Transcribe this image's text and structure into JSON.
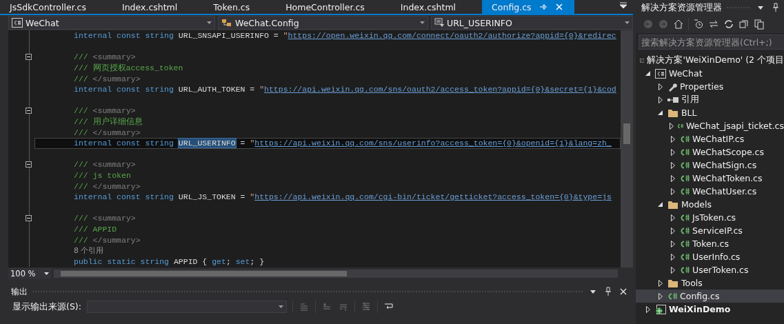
{
  "editor_tabs": [
    {
      "label": "JsSdkController.cs",
      "selected": false
    },
    {
      "label": "Index.cshtml",
      "selected": false
    },
    {
      "label": "Token.cs",
      "selected": false
    },
    {
      "label": "HomeController.cs",
      "selected": false
    },
    {
      "label": "Index.cshtml",
      "selected": false
    },
    {
      "label": "Config.cs",
      "selected": true
    }
  ],
  "nav_bar": {
    "project": "WeChat",
    "type": "WeChat.Config",
    "member": "URL_USERINFO"
  },
  "code_lines": [
    {
      "kind": "code",
      "fold": false,
      "current": false,
      "segments": [
        {
          "kind": "kw",
          "t": "internal const string "
        },
        {
          "kind": "id",
          "t": "URL_SNSAPI_USERINFO = "
        },
        {
          "kind": "punc",
          "t": "\""
        },
        {
          "kind": "link",
          "t": "https://open.weixin.qq.com/connect/oauth2/authorize?appid={0}&redirec"
        }
      ]
    },
    {
      "kind": "blank",
      "fold": false,
      "current": false
    },
    {
      "kind": "code",
      "fold": true,
      "current": false,
      "segments": [
        {
          "kind": "doc",
          "t": "/// "
        },
        {
          "kind": "tag",
          "t": "<summary>"
        }
      ]
    },
    {
      "kind": "code",
      "fold": false,
      "current": false,
      "segments": [
        {
          "kind": "doc",
          "t": "/// 网页授权access_token"
        }
      ]
    },
    {
      "kind": "code",
      "fold": false,
      "current": false,
      "segments": [
        {
          "kind": "doc",
          "t": "/// "
        },
        {
          "kind": "tag",
          "t": "</summary>"
        }
      ]
    },
    {
      "kind": "code",
      "fold": false,
      "current": false,
      "segments": [
        {
          "kind": "kw",
          "t": "internal const string "
        },
        {
          "kind": "id",
          "t": "URL_AUTH_TOKEN = "
        },
        {
          "kind": "punc",
          "t": "\""
        },
        {
          "kind": "link",
          "t": "https://api.weixin.qq.com/sns/oauth2/access_token?appid={0}&secret={1}&cod"
        }
      ]
    },
    {
      "kind": "blank",
      "fold": false,
      "current": false
    },
    {
      "kind": "code",
      "fold": true,
      "current": false,
      "segments": [
        {
          "kind": "doc",
          "t": "/// "
        },
        {
          "kind": "tag",
          "t": "<summary>"
        }
      ]
    },
    {
      "kind": "code",
      "fold": false,
      "current": false,
      "segments": [
        {
          "kind": "doc",
          "t": "/// 用户详细信息"
        }
      ]
    },
    {
      "kind": "code",
      "fold": false,
      "current": false,
      "segments": [
        {
          "kind": "doc",
          "t": "/// "
        },
        {
          "kind": "tag",
          "t": "</summary>"
        }
      ]
    },
    {
      "kind": "code",
      "fold": false,
      "current": true,
      "segments": [
        {
          "kind": "kw",
          "t": "internal const string "
        },
        {
          "kind": "sel",
          "t": "URL_USERINFO"
        },
        {
          "kind": "id",
          "t": " = "
        },
        {
          "kind": "punc",
          "t": "\""
        },
        {
          "kind": "link",
          "t": "https://api.weixin.qq.com/sns/userinfo?access_token={0}&openid={1}&lang=zh_"
        }
      ]
    },
    {
      "kind": "blank",
      "fold": false,
      "current": false
    },
    {
      "kind": "code",
      "fold": true,
      "current": false,
      "segments": [
        {
          "kind": "doc",
          "t": "/// "
        },
        {
          "kind": "tag",
          "t": "<summary>"
        }
      ]
    },
    {
      "kind": "code",
      "fold": false,
      "current": false,
      "segments": [
        {
          "kind": "doc",
          "t": "/// js token"
        }
      ]
    },
    {
      "kind": "code",
      "fold": false,
      "current": false,
      "segments": [
        {
          "kind": "doc",
          "t": "/// "
        },
        {
          "kind": "tag",
          "t": "</summary>"
        }
      ]
    },
    {
      "kind": "code",
      "fold": false,
      "current": false,
      "segments": [
        {
          "kind": "kw",
          "t": "internal const string "
        },
        {
          "kind": "id",
          "t": "URL_JS_TOKEN = "
        },
        {
          "kind": "punc",
          "t": "\""
        },
        {
          "kind": "link",
          "t": "https://api.weixin.qq.com/cgi-bin/ticket/getticket?access_token={0}&type=js"
        }
      ]
    },
    {
      "kind": "blank",
      "fold": false,
      "current": false
    },
    {
      "kind": "code",
      "fold": true,
      "current": false,
      "segments": [
        {
          "kind": "doc",
          "t": "/// "
        },
        {
          "kind": "tag",
          "t": "<summary>"
        }
      ]
    },
    {
      "kind": "code",
      "fold": false,
      "current": false,
      "segments": [
        {
          "kind": "doc",
          "t": "/// APPID"
        }
      ]
    },
    {
      "kind": "code",
      "fold": false,
      "current": false,
      "segments": [
        {
          "kind": "doc",
          "t": "/// "
        },
        {
          "kind": "tag",
          "t": "</summary>"
        }
      ]
    },
    {
      "kind": "lens",
      "fold": false,
      "current": false,
      "segments": [
        {
          "kind": "lens",
          "t": "8 个引用"
        }
      ]
    },
    {
      "kind": "code",
      "fold": false,
      "current": false,
      "segments": [
        {
          "kind": "kw",
          "t": "public static string "
        },
        {
          "kind": "id",
          "t": "APPID { "
        },
        {
          "kind": "kw",
          "t": "get"
        },
        {
          "kind": "id",
          "t": "; "
        },
        {
          "kind": "kw",
          "t": "set"
        },
        {
          "kind": "id",
          "t": "; }"
        }
      ]
    }
  ],
  "zoom": "100 %",
  "output_panel": {
    "title": "输出",
    "source_label": "显示输出来源(S):"
  },
  "solution_explorer": {
    "title": "解决方案资源管理器",
    "search_placeholder": "搜索解决方案资源管理器(Ctrl+;)",
    "tree": [
      {
        "label": "解决方案'WeiXinDemo' (2 个项目",
        "kind": "solution",
        "selected": false,
        "children": [
          {
            "label": "WeChat",
            "kind": "project",
            "expanded": true,
            "selected": false,
            "children": [
              {
                "label": "Properties",
                "kind": "properties",
                "expanded": false,
                "selected": false
              },
              {
                "label": "引用",
                "kind": "references",
                "expanded": false,
                "selected": false
              },
              {
                "label": "BLL",
                "kind": "folder",
                "expanded": true,
                "selected": false,
                "children": [
                  {
                    "label": "WeChat_jsapi_ticket.cs",
                    "kind": "cs",
                    "expanded": false,
                    "selected": false
                  },
                  {
                    "label": "WeChatIP.cs",
                    "kind": "cs",
                    "expanded": false,
                    "selected": false
                  },
                  {
                    "label": "WeChatScope.cs",
                    "kind": "cs",
                    "expanded": false,
                    "selected": false
                  },
                  {
                    "label": "WeChatSign.cs",
                    "kind": "cs",
                    "expanded": false,
                    "selected": false
                  },
                  {
                    "label": "WeChatToken.cs",
                    "kind": "cs",
                    "expanded": false,
                    "selected": false
                  },
                  {
                    "label": "WeChatUser.cs",
                    "kind": "cs",
                    "expanded": false,
                    "selected": false
                  }
                ]
              },
              {
                "label": "Models",
                "kind": "folder",
                "expanded": true,
                "selected": false,
                "children": [
                  {
                    "label": "JsToken.cs",
                    "kind": "cs",
                    "expanded": false,
                    "selected": false
                  },
                  {
                    "label": "ServiceIP.cs",
                    "kind": "cs",
                    "expanded": false,
                    "selected": false
                  },
                  {
                    "label": "Token.cs",
                    "kind": "cs",
                    "expanded": false,
                    "selected": false
                  },
                  {
                    "label": "UserInfo.cs",
                    "kind": "cs",
                    "expanded": false,
                    "selected": false
                  },
                  {
                    "label": "UserToken.cs",
                    "kind": "cs",
                    "expanded": false,
                    "selected": false
                  }
                ]
              },
              {
                "label": "Tools",
                "kind": "folder",
                "expanded": false,
                "selected": false
              },
              {
                "label": "Config.cs",
                "kind": "cs",
                "expanded": false,
                "selected": true
              }
            ]
          },
          {
            "label": "WeiXinDemo",
            "kind": "startup_project",
            "expanded": false,
            "selected": false
          }
        ]
      }
    ]
  }
}
